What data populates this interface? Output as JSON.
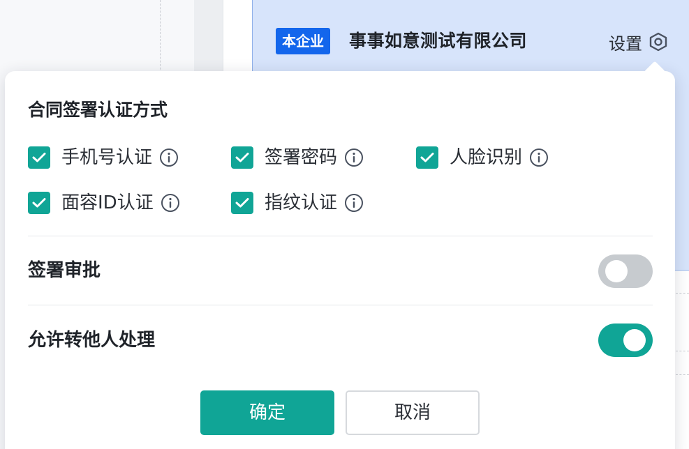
{
  "background": {
    "company_tag": "本企业",
    "company_name": "事事如意测试有限公司",
    "settings_label": "设置"
  },
  "auth_methods": {
    "title": "合同签署认证方式",
    "options": [
      {
        "label": "手机号认证",
        "checked": true
      },
      {
        "label": "签署密码",
        "checked": true
      },
      {
        "label": "人脸识别",
        "checked": true
      },
      {
        "label": "面容ID认证",
        "checked": true
      },
      {
        "label": "指纹认证",
        "checked": true
      }
    ]
  },
  "sign_approval": {
    "label": "签署审批",
    "enabled": false
  },
  "allow_transfer": {
    "label": "允许转他人处理",
    "enabled": true
  },
  "actions": {
    "confirm_label": "确定",
    "cancel_label": "取消"
  },
  "colors": {
    "accent": "#10a596",
    "brand_blue": "#1366ec",
    "card_bg": "#d7e4fb"
  },
  "icons": [
    "settings-hexagon-icon",
    "checkmark-icon",
    "info-icon"
  ]
}
